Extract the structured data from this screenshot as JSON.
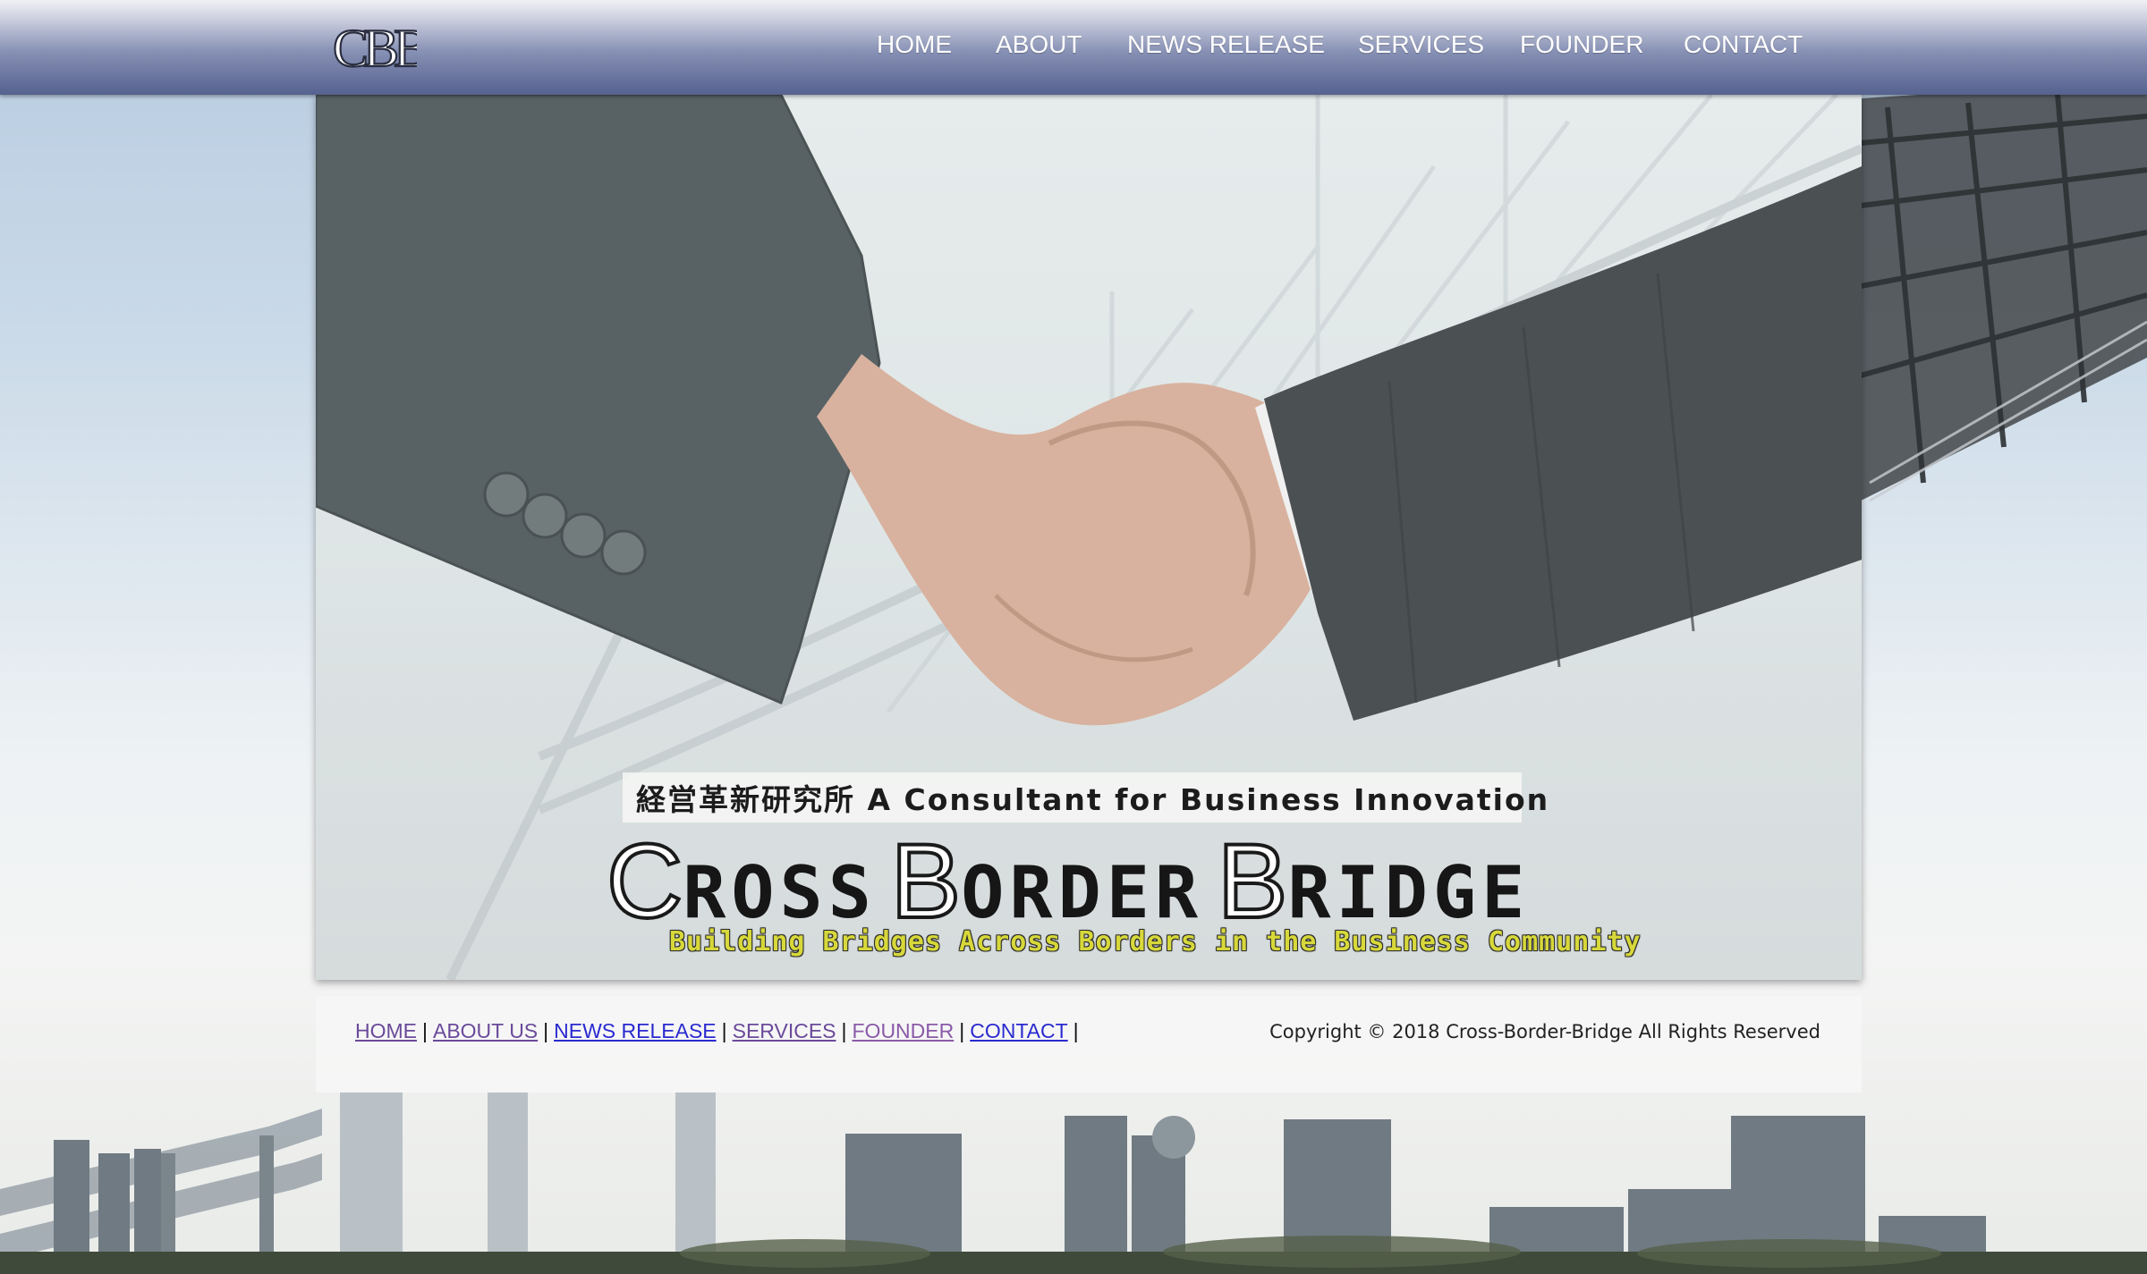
{
  "header": {
    "logo_text": "CBBC",
    "nav": [
      {
        "label": "HOME"
      },
      {
        "label": "ABOUT"
      },
      {
        "label": "NEWS RELEASE"
      },
      {
        "label": "SERVICES"
      },
      {
        "label": "FOUNDER"
      },
      {
        "label": "CONTACT"
      }
    ]
  },
  "hero": {
    "tagline": "経営革新研究所  A Consultant for Business Innovation",
    "brand": {
      "word1_initial": "C",
      "word1_rest": "ROSS",
      "word2_initial": "B",
      "word2_rest": "ORDER",
      "word3_initial": "B",
      "word3_rest": "RIDGE"
    },
    "slogan": "Building Bridges Across Borders in the Business Community"
  },
  "footer": {
    "links": [
      {
        "label": "HOME",
        "color": "#6a4a9a"
      },
      {
        "label": "ABOUT US",
        "color": "#6a4a9a"
      },
      {
        "label": "NEWS RELEASE",
        "color": "#2a2ad0"
      },
      {
        "label": "SERVICES",
        "color": "#6a4a9a"
      },
      {
        "label": "FOUNDER",
        "color": "#8a5aa8"
      },
      {
        "label": "CONTACT",
        "color": "#2a2ad0"
      }
    ],
    "copyright": "Copyright © 2018 Cross-Border-Bridge All Rights Reserved"
  },
  "colors": {
    "nav_bar": "#56628f",
    "nav_text": "#ffffff",
    "slogan": "#d7d83a"
  }
}
